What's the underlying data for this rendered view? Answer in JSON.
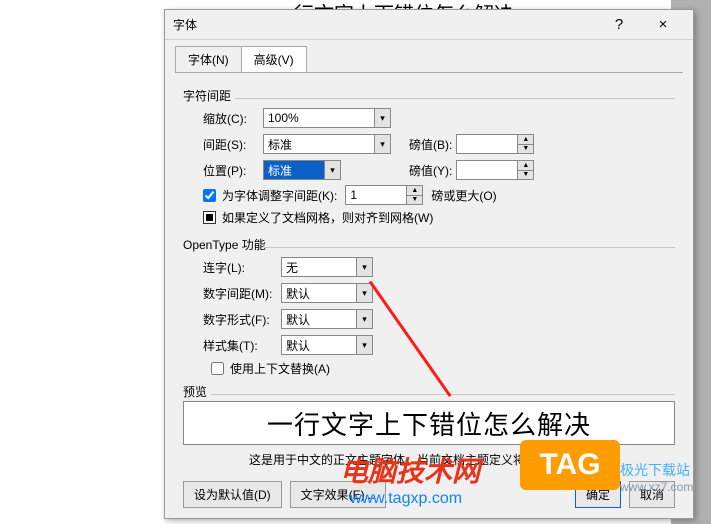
{
  "bg_heading": "一行文字上下错位怎么解决",
  "dialog": {
    "title": "字体",
    "help": "?",
    "close": "×",
    "tabs": {
      "tab1": "字体(N)",
      "tab2": "高级(V)"
    },
    "spacing_group": "字符间距",
    "scale_label": "缩放(C):",
    "scale_value": "100%",
    "spacing_label": "间距(S):",
    "spacing_value": "标准",
    "point_label": "磅值(B):",
    "point_value": "",
    "position_label": "位置(P):",
    "position_value": "标准",
    "point2_label": "磅值(Y):",
    "point2_value": "",
    "kerning_chk": "为字体调整字间距(K):",
    "kerning_value": "1",
    "kerning_suffix": "磅或更大(O)",
    "grid_chk": "如果定义了文档网格，则对齐到网格(W)",
    "opentype_group": "OpenType 功能",
    "ligature_label": "连字(L):",
    "ligature_value": "无",
    "numspace_label": "数字间距(M):",
    "numspace_value": "默认",
    "numform_label": "数字形式(F):",
    "numform_value": "默认",
    "styleset_label": "样式集(T):",
    "styleset_value": "默认",
    "context_chk": "使用上下文替换(A)",
    "preview_group": "预览",
    "preview_text": "一行文字上下错位怎么解决",
    "preview_desc": "这是用于中文的正文主题字体。当前文档主题定义将使用哪种字体。",
    "btn_default": "设为默认值(D)",
    "btn_effects": "文字效果(E)...",
    "btn_ok": "确定",
    "btn_cancel": "取消"
  },
  "overlay": {
    "title": "电脑技术网",
    "url": "www.tagxp.com",
    "tag": "TAG",
    "site_name": "极光下载站",
    "site_url": "www.xz7.com"
  }
}
